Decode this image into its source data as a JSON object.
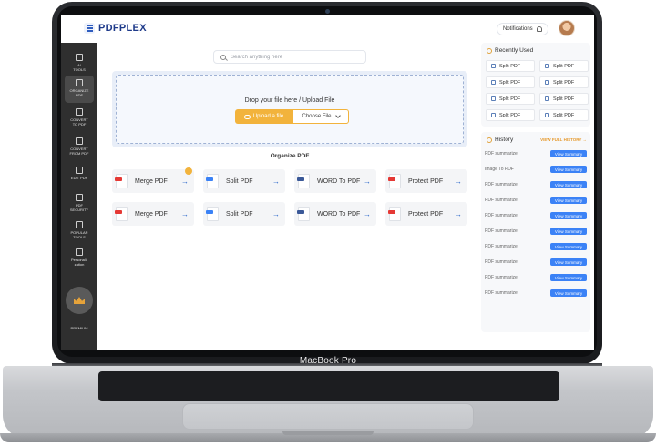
{
  "device": {
    "label": "MacBook Pro"
  },
  "app": {
    "name": "PDFPLEX",
    "notifications_label": "Notifications"
  },
  "sidebar": {
    "items": [
      {
        "label": "AI\nTOOLS"
      },
      {
        "label": "ORGANIZE\nPDF",
        "active": true
      },
      {
        "label": "CONVERT\nTO PDF"
      },
      {
        "label": "CONVERT\nFROM PDF"
      },
      {
        "label": "EDIT PDF"
      },
      {
        "label": "PDF\nSECURITY"
      },
      {
        "label": "POPULAR\nTOOLS"
      },
      {
        "label": "Personali-\nzation"
      }
    ],
    "premium_label": "PREMIUM"
  },
  "search": {
    "placeholder": "Search anything here"
  },
  "upload": {
    "prompt": "Drop your file here / Upload File",
    "upload_button": "Upload a file",
    "choose_button": "Choose File"
  },
  "organize": {
    "title": "Organize PDF",
    "tools": [
      {
        "label": "Merge PDF",
        "badge": "PDF",
        "color": "#e53935"
      },
      {
        "label": "Split PDF",
        "badge": "PDF",
        "color": "#3b82f6"
      },
      {
        "label": "WORD To PDF",
        "badge": "DOC",
        "color": "#3b5998"
      },
      {
        "label": "Protect PDF",
        "badge": "PDF",
        "color": "#e53935"
      },
      {
        "label": "Merge PDF",
        "badge": "PDF",
        "color": "#e53935"
      },
      {
        "label": "Split PDF",
        "badge": "PDF",
        "color": "#3b82f6"
      },
      {
        "label": "WORD To PDF",
        "badge": "DOC",
        "color": "#3b5998"
      },
      {
        "label": "Protect PDF",
        "badge": "PDF",
        "color": "#e53935"
      }
    ]
  },
  "recently_used": {
    "title": "Recently Used",
    "items": [
      "Split PDF",
      "Split PDF",
      "Split PDF",
      "Split PDF",
      "Split PDF",
      "Split PDF",
      "Split PDF",
      "Split PDF"
    ]
  },
  "history": {
    "title": "History",
    "view_full": "VIEW FULL HISTORY →",
    "button_label": "View Summary",
    "rows": [
      "PDF summarize",
      "Image To PDF",
      "PDF summarize",
      "PDF summarize",
      "PDF summarize",
      "PDF summarize",
      "PDF summarize",
      "PDF summarize",
      "PDF summarize",
      "PDF summarize"
    ]
  },
  "colors": {
    "accent": "#f2b33c",
    "primary": "#3b82f6",
    "sidebar": "#2f2f2f"
  }
}
